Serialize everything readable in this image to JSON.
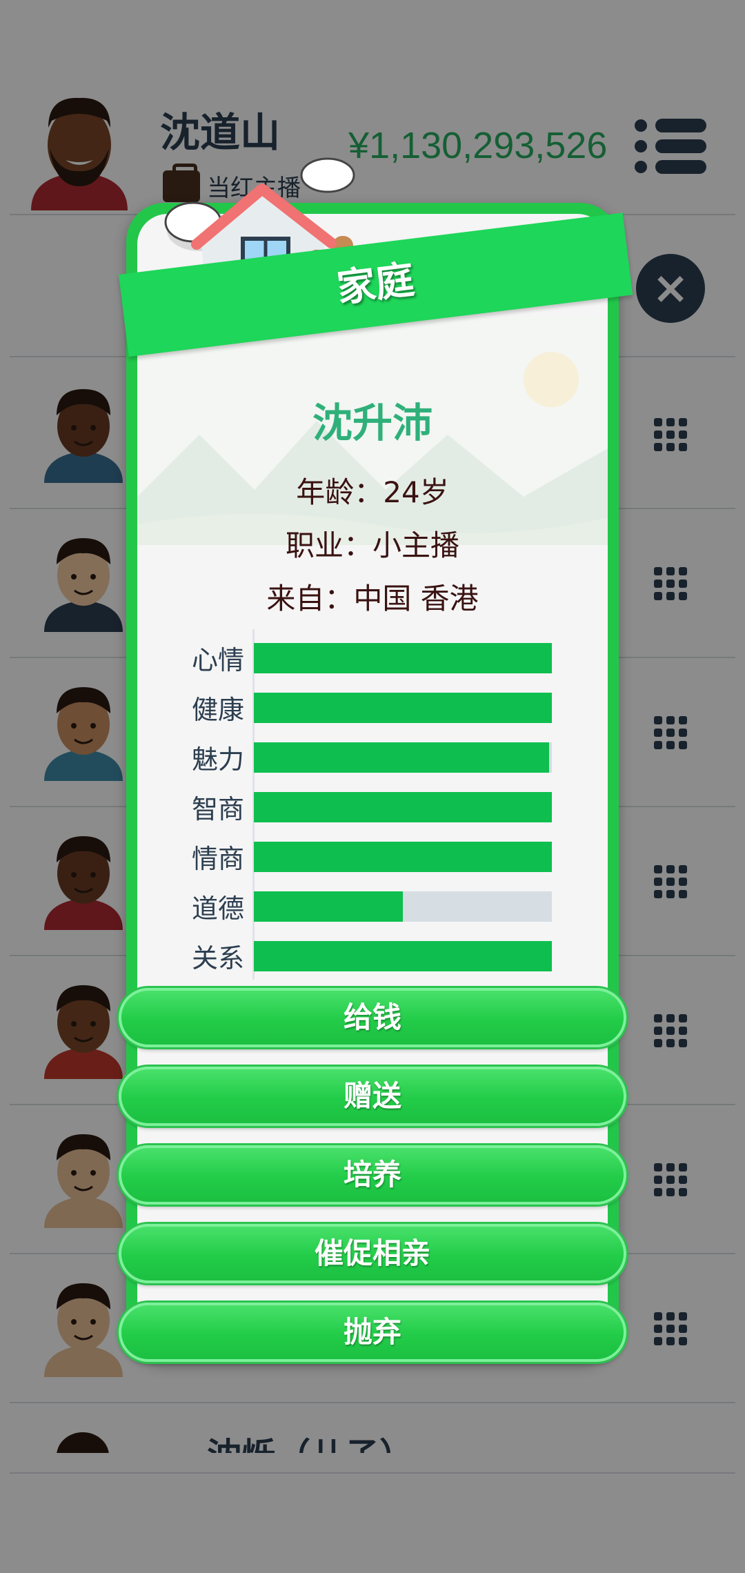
{
  "header": {
    "name": "沈道山",
    "subtitle": "当红主播",
    "money": "¥1,130,293,526",
    "menu_icon": "menu-list-icon"
  },
  "close_icon": "×",
  "family_list": {
    "row_icon": "grid-icon",
    "partial_name": "沈烁（儿子）"
  },
  "dialog": {
    "title": "家庭",
    "child_name": "沈升沛",
    "age": "年龄：24岁",
    "job": "职业：小主播",
    "origin": "来自：中国 香港",
    "stats": [
      {
        "label": "心情",
        "value": 1.0
      },
      {
        "label": "健康",
        "value": 1.0
      },
      {
        "label": "魅力",
        "value": 0.99
      },
      {
        "label": "智商",
        "value": 1.0
      },
      {
        "label": "情商",
        "value": 1.0
      },
      {
        "label": "道德",
        "value": 0.5
      },
      {
        "label": "关系",
        "value": 1.0
      }
    ],
    "buttons": [
      "给钱",
      "赠送",
      "培养",
      "催促相亲",
      "抛弃"
    ]
  },
  "colors": {
    "accent_green": "#22c74a",
    "stat_fill": "#0ebf4f",
    "child_name": "#2fb07a",
    "money": "#27ae60",
    "dark": "#2c3e50"
  }
}
